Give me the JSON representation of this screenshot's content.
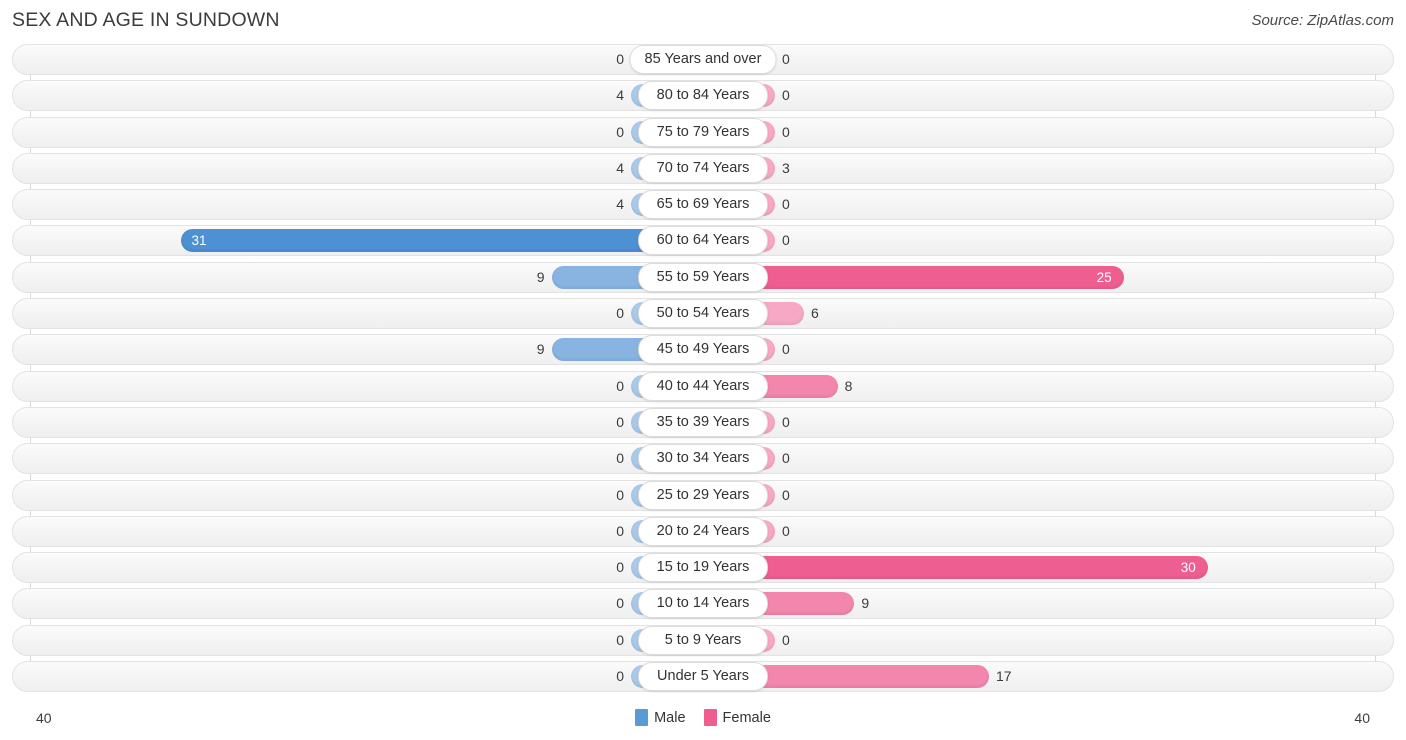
{
  "header": {
    "title": "SEX AND AGE IN SUNDOWN",
    "source": "Source: ZipAtlas.com"
  },
  "legend": {
    "male_label": "Male",
    "female_label": "Female",
    "male_color": "#5b9bd5",
    "female_color": "#ef5e90"
  },
  "axis": {
    "left_label": "40",
    "right_label": "40",
    "max": 40
  },
  "chart_data": {
    "type": "bar",
    "subtype": "population-pyramid",
    "title": "SEX AND AGE IN SUNDOWN",
    "xlabel": "",
    "ylabel": "",
    "xlim": [
      40,
      40
    ],
    "grid": true,
    "legend_position": "bottom-center",
    "categories": [
      "85 Years and over",
      "80 to 84 Years",
      "75 to 79 Years",
      "70 to 74 Years",
      "65 to 69 Years",
      "60 to 64 Years",
      "55 to 59 Years",
      "50 to 54 Years",
      "45 to 49 Years",
      "40 to 44 Years",
      "35 to 39 Years",
      "30 to 34 Years",
      "25 to 29 Years",
      "20 to 24 Years",
      "15 to 19 Years",
      "10 to 14 Years",
      "5 to 9 Years",
      "Under 5 Years"
    ],
    "series": [
      {
        "name": "Male",
        "values": [
          0,
          4,
          0,
          4,
          4,
          31,
          9,
          0,
          9,
          0,
          0,
          0,
          0,
          0,
          0,
          0,
          0,
          0
        ]
      },
      {
        "name": "Female",
        "values": [
          0,
          0,
          0,
          3,
          0,
          0,
          25,
          6,
          0,
          8,
          0,
          0,
          0,
          0,
          30,
          9,
          0,
          17
        ]
      }
    ]
  },
  "rows": [
    {
      "age": "85 Years and over",
      "male": "0",
      "female": "0",
      "male_val": 0,
      "female_val": 0
    },
    {
      "age": "80 to 84 Years",
      "male": "4",
      "female": "0",
      "male_val": 4,
      "female_val": 0
    },
    {
      "age": "75 to 79 Years",
      "male": "0",
      "female": "0",
      "male_val": 0,
      "female_val": 0
    },
    {
      "age": "70 to 74 Years",
      "male": "4",
      "female": "3",
      "male_val": 4,
      "female_val": 3
    },
    {
      "age": "65 to 69 Years",
      "male": "4",
      "female": "0",
      "male_val": 4,
      "female_val": 0
    },
    {
      "age": "60 to 64 Years",
      "male": "31",
      "female": "0",
      "male_val": 31,
      "female_val": 0
    },
    {
      "age": "55 to 59 Years",
      "male": "9",
      "female": "25",
      "male_val": 9,
      "female_val": 25
    },
    {
      "age": "50 to 54 Years",
      "male": "0",
      "female": "6",
      "male_val": 0,
      "female_val": 6
    },
    {
      "age": "45 to 49 Years",
      "male": "9",
      "female": "0",
      "male_val": 9,
      "female_val": 0
    },
    {
      "age": "40 to 44 Years",
      "male": "0",
      "female": "8",
      "male_val": 0,
      "female_val": 8
    },
    {
      "age": "35 to 39 Years",
      "male": "0",
      "female": "0",
      "male_val": 0,
      "female_val": 0
    },
    {
      "age": "30 to 34 Years",
      "male": "0",
      "female": "0",
      "male_val": 0,
      "female_val": 0
    },
    {
      "age": "25 to 29 Years",
      "male": "0",
      "female": "0",
      "male_val": 0,
      "female_val": 0
    },
    {
      "age": "20 to 24 Years",
      "male": "0",
      "female": "0",
      "male_val": 0,
      "female_val": 0
    },
    {
      "age": "15 to 19 Years",
      "male": "0",
      "female": "30",
      "male_val": 0,
      "female_val": 30
    },
    {
      "age": "10 to 14 Years",
      "male": "0",
      "female": "9",
      "male_val": 0,
      "female_val": 9
    },
    {
      "age": "5 to 9 Years",
      "male": "0",
      "female": "0",
      "male_val": 0,
      "female_val": 0
    },
    {
      "age": "Under 5 Years",
      "male": "0",
      "female": "17",
      "male_val": 0,
      "female_val": 17
    }
  ]
}
